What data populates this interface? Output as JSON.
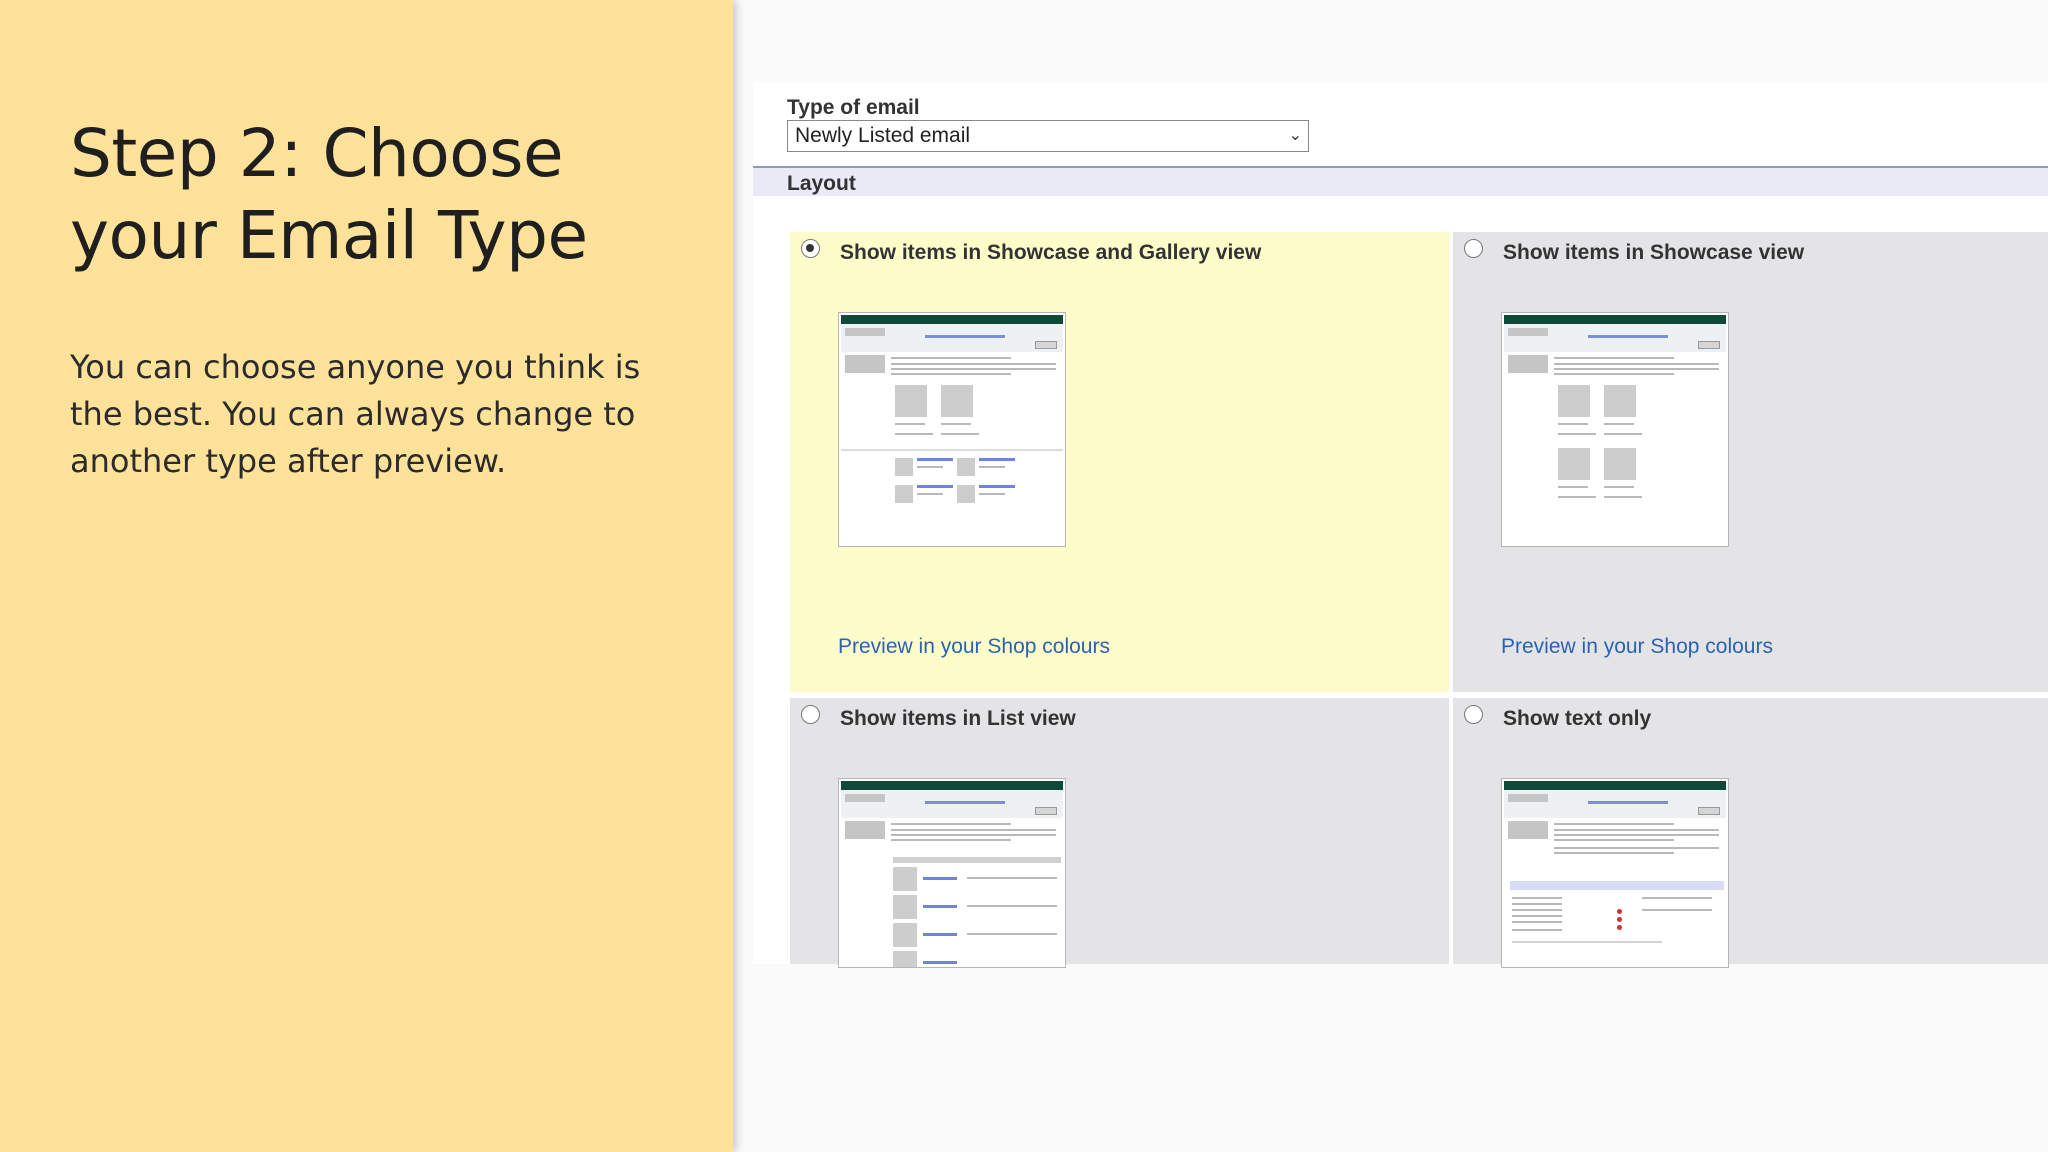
{
  "slide": {
    "title": "Step 2: Choose your Email Type",
    "body": "You can choose anyone you think is the best. You can always change to another type after preview."
  },
  "form": {
    "type_label": "Type of email",
    "type_value": "Newly Listed email",
    "layout_label": "Layout",
    "options": [
      {
        "label": "Show items in Showcase and Gallery view",
        "selected": true,
        "preview_link": "Preview in your Shop colours"
      },
      {
        "label": "Show items in Showcase view",
        "selected": false,
        "preview_link": "Preview in your Shop colours"
      },
      {
        "label": "Show items in List view",
        "selected": false
      },
      {
        "label": "Show text only",
        "selected": false
      }
    ]
  },
  "colors": {
    "slide_bg": "#fee29a",
    "selected_option_bg": "#fefdca",
    "option_bg": "#e4e4e6",
    "link": "#2a62b5"
  }
}
